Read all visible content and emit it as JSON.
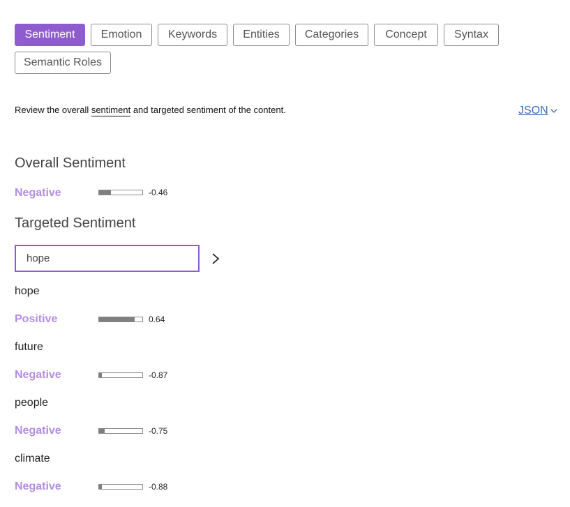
{
  "tabs": [
    {
      "label": "Sentiment",
      "active": true
    },
    {
      "label": "Emotion",
      "active": false
    },
    {
      "label": "Keywords",
      "active": false
    },
    {
      "label": "Entities",
      "active": false
    },
    {
      "label": "Categories",
      "active": false
    },
    {
      "label": "Concept",
      "active": false
    },
    {
      "label": "Syntax",
      "active": false
    },
    {
      "label": "Semantic Roles",
      "active": false
    }
  ],
  "intro": {
    "before": "Review the overall ",
    "term": "sentiment",
    "after": " and targeted sentiment of the content."
  },
  "json_link": "JSON",
  "overall": {
    "title": "Overall Sentiment",
    "label": "Negative",
    "score": "-0.46",
    "score_value": -0.46
  },
  "targeted": {
    "title": "Targeted Sentiment",
    "search_value": "hope",
    "items": [
      {
        "target": "hope",
        "label": "Positive",
        "score": "0.64",
        "score_value": 0.64
      },
      {
        "target": "future",
        "label": "Negative",
        "score": "-0.87",
        "score_value": -0.87
      },
      {
        "target": "people",
        "label": "Negative",
        "score": "-0.75",
        "score_value": -0.75
      },
      {
        "target": "climate",
        "label": "Negative",
        "score": "-0.88",
        "score_value": -0.88
      }
    ]
  },
  "colors": {
    "accent": "#8f5ccf",
    "sentiment_label": "#b38de0",
    "link": "#3b6db5",
    "bar_fill": "#7f7f7f"
  }
}
